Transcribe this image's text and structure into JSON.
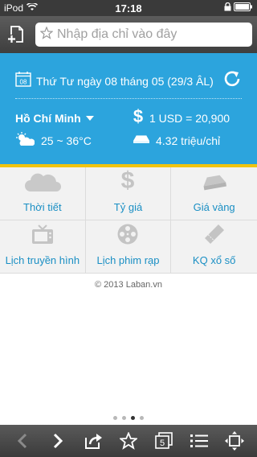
{
  "status": {
    "carrier": "iPod",
    "time": "17:18"
  },
  "search": {
    "placeholder": "Nhập địa chỉ vào đây"
  },
  "info": {
    "date": "Thứ Tư ngày 08 tháng 05 (29/3 ÂL)",
    "calendar_day": "08",
    "city": "Hồ Chí Minh",
    "exchange_rate": "1 USD = 20,900",
    "temperature": "25 ~ 36°C",
    "gold_price": "4.32 triệu/chỉ"
  },
  "tiles": [
    {
      "label": "Thời tiết",
      "icon": "cloud-icon"
    },
    {
      "label": "Tỷ giá",
      "icon": "dollar-icon"
    },
    {
      "label": "Giá vàng",
      "icon": "gold-bar-icon"
    },
    {
      "label": "Lịch truyền hình",
      "icon": "tv-icon"
    },
    {
      "label": "Lịch phim rạp",
      "icon": "film-reel-icon"
    },
    {
      "label": "KQ xổ số",
      "icon": "ticket-icon"
    }
  ],
  "footer": {
    "copyright": "© 2013 Laban.vn"
  },
  "pager": {
    "total": 4,
    "active": 3
  },
  "toolbar": {
    "tab_count": "5"
  },
  "colors": {
    "hero_blue": "#2ca4dd",
    "accent_yellow": "#f1c40f",
    "tile_text": "#1a8fc4"
  }
}
